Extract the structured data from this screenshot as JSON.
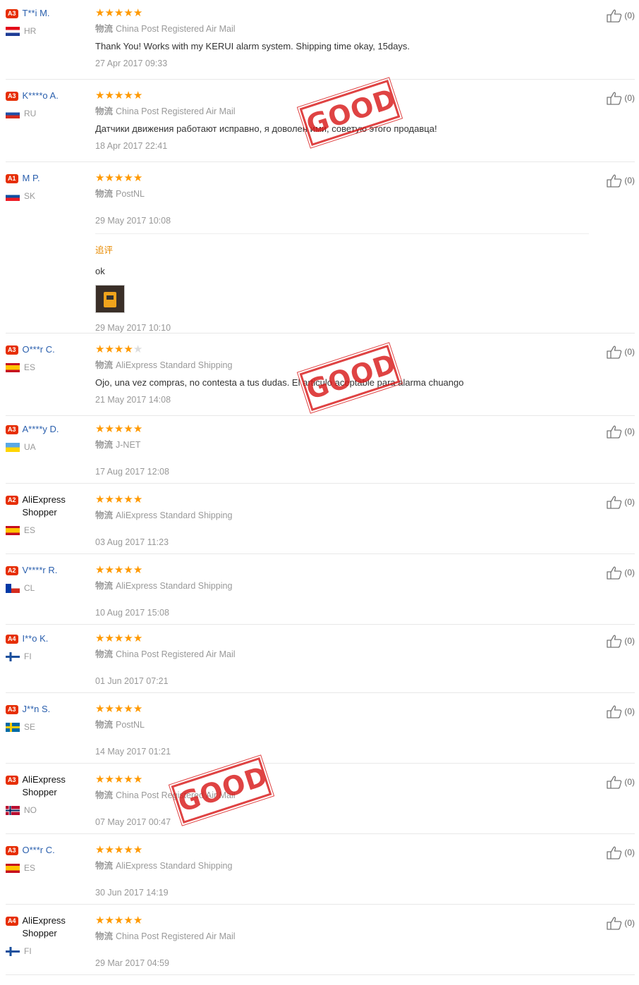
{
  "ship_label": "物流",
  "helpful_count": "(0)",
  "stamp_text": "GOOD",
  "reviews": [
    {
      "level": "A3",
      "name": "T**i M.",
      "country": "HR",
      "stars": 5,
      "shipping": "China Post Registered Air Mail",
      "text": "Thank You! Works with my KERUI alarm system. Shipping time okay, 15days.",
      "date": "27 Apr 2017 09:33"
    },
    {
      "level": "A3",
      "name": "K****o A.",
      "country": "RU",
      "stars": 5,
      "shipping": "China Post Registered Air Mail",
      "text": "Датчики движения работают исправно, я доволен ими, советую этого продавца!",
      "date": "18 Apr 2017 22:41"
    },
    {
      "level": "A1",
      "name": "M P.",
      "country": "SK",
      "stars": 5,
      "shipping": "PostNL",
      "text": "",
      "date": "29 May 2017 10:08",
      "append": {
        "label": "追评",
        "text": "ok",
        "date": "29 May 2017 10:10"
      }
    },
    {
      "level": "A3",
      "name": "O***r C.",
      "country": "ES",
      "stars": 4,
      "shipping": "AliExpress Standard Shipping",
      "text": "Ojo, una vez compras, no contesta a tus dudas. El articulo aceptable para alarma chuango",
      "date": "21 May 2017 14:08"
    },
    {
      "level": "A3",
      "name": "A****y D.",
      "country": "UA",
      "stars": 5,
      "shipping": "J-NET",
      "text": "",
      "date": "17 Aug 2017 12:08"
    },
    {
      "level": "A2",
      "name": "AliExpress Shopper",
      "country": "ES",
      "stars": 5,
      "shipping": "AliExpress Standard Shipping",
      "text": "",
      "date": "03 Aug 2017 11:23"
    },
    {
      "level": "A2",
      "name": "V****r R.",
      "country": "CL",
      "stars": 5,
      "shipping": "AliExpress Standard Shipping",
      "text": "",
      "date": "10 Aug 2017 15:08"
    },
    {
      "level": "A4",
      "name": "I**o K.",
      "country": "FI",
      "stars": 5,
      "shipping": "China Post Registered Air Mail",
      "text": "",
      "date": "01 Jun 2017 07:21"
    },
    {
      "level": "A3",
      "name": "J**n S.",
      "country": "SE",
      "stars": 5,
      "shipping": "PostNL",
      "text": "",
      "date": "14 May 2017 01:21"
    },
    {
      "level": "A3",
      "name": "AliExpress Shopper",
      "country": "NO",
      "stars": 5,
      "shipping": "China Post Registered Air Mail",
      "text": "",
      "date": "07 May 2017 00:47"
    },
    {
      "level": "A3",
      "name": "O***r C.",
      "country": "ES",
      "stars": 5,
      "shipping": "AliExpress Standard Shipping",
      "text": "",
      "date": "30 Jun 2017 14:19"
    },
    {
      "level": "A4",
      "name": "AliExpress Shopper",
      "country": "FI",
      "stars": 5,
      "shipping": "China Post Registered Air Mail",
      "text": "",
      "date": "29 Mar 2017 04:59"
    }
  ]
}
